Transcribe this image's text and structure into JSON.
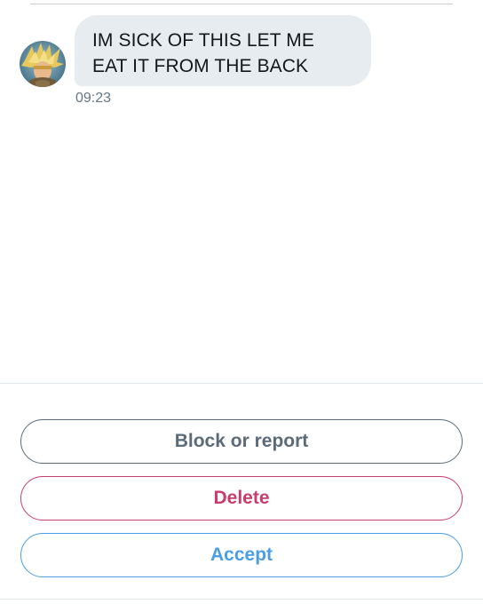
{
  "conversation": {
    "message": {
      "text": "IM SICK OF THIS LET ME EAT IT FROM THE BACK",
      "time": "09:23"
    },
    "avatar_icon": "avatar-anime-character-icon"
  },
  "actions": {
    "block_label": "Block or report",
    "delete_label": "Delete",
    "accept_label": "Accept"
  },
  "colors": {
    "bubble_bg": "#e6ecf0",
    "block": "#5b6b7a",
    "delete": "#c73e6b",
    "accept": "#4a9ee6",
    "timestamp": "#657786"
  }
}
